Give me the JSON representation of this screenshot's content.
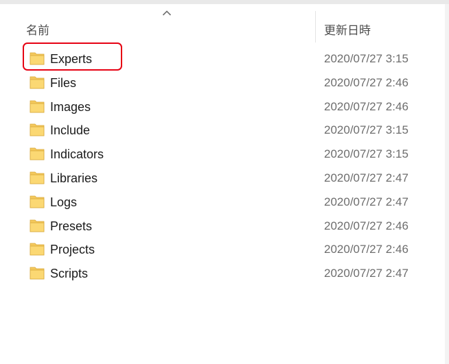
{
  "columns": {
    "name": "名前",
    "modified": "更新日時"
  },
  "sort_indicator_icon": "chevron-up-icon",
  "folder_icon_color": "#f4c95d",
  "highlight_color": "#e60012",
  "rows": [
    {
      "name": "Experts",
      "date": "2020/07/27 3:15",
      "highlighted": true
    },
    {
      "name": "Files",
      "date": "2020/07/27 2:46"
    },
    {
      "name": "Images",
      "date": "2020/07/27 2:46"
    },
    {
      "name": "Include",
      "date": "2020/07/27 3:15"
    },
    {
      "name": "Indicators",
      "date": "2020/07/27 3:15"
    },
    {
      "name": "Libraries",
      "date": "2020/07/27 2:47"
    },
    {
      "name": "Logs",
      "date": "2020/07/27 2:47"
    },
    {
      "name": "Presets",
      "date": "2020/07/27 2:46"
    },
    {
      "name": "Projects",
      "date": "2020/07/27 2:46"
    },
    {
      "name": "Scripts",
      "date": "2020/07/27 2:47"
    }
  ]
}
